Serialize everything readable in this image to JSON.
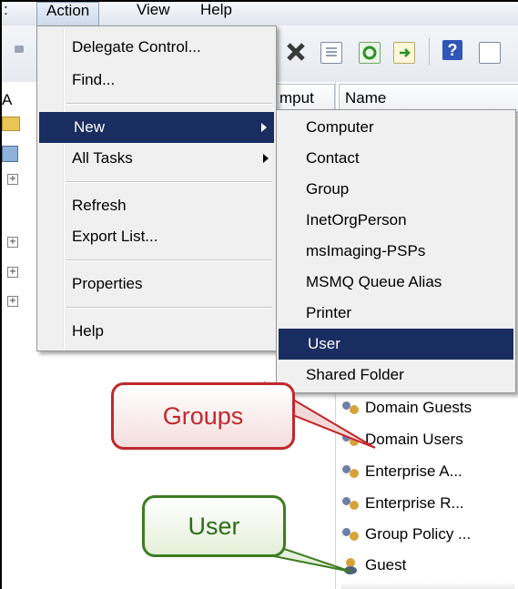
{
  "menubar": {
    "prev_fragment": ":",
    "action": "Action",
    "view": "View",
    "help": "Help"
  },
  "left_pane": {
    "header_fragment": "A"
  },
  "columns": {
    "computer_fragment": "mput",
    "name": "Name"
  },
  "action_menu": {
    "items": [
      "Delegate Control...",
      "Find...",
      "New",
      "All Tasks",
      "Refresh",
      "Export List...",
      "Properties",
      "Help"
    ]
  },
  "new_submenu": {
    "items": [
      "Computer",
      "Contact",
      "Group",
      "InetOrgPerson",
      "msImaging-PSPs",
      "MSMQ Queue Alias",
      "Printer",
      "User",
      "Shared Folder"
    ],
    "selected": "User"
  },
  "list_items": [
    "Domain Guests",
    "Domain Users",
    "Enterprise A...",
    "Enterprise R...",
    "Group Policy ...",
    "Guest"
  ],
  "callouts": {
    "groups": "Groups",
    "user": "User"
  },
  "colors": {
    "groups_text": "#c0282c",
    "user_text": "#2e6b1a",
    "selection": "#1a2d60"
  }
}
